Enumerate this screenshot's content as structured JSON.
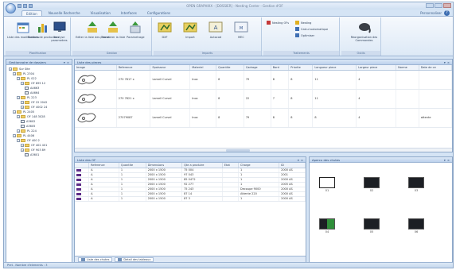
{
  "app": {
    "title": "OPEN GRAPHIXX - [DOSSIER] - Nesting Center - Gestion d'OF",
    "accent": "#3f6fb3"
  },
  "tabs": [
    "Edition",
    "Nouvelle Recherche",
    "Visualisation",
    "Interfaces",
    "Configurations"
  ],
  "active_tab": 0,
  "help": {
    "label": "Personnaliser",
    "icon": "help-icon"
  },
  "ribbon": {
    "groups": [
      {
        "title": "Planification",
        "buttons": [
          "Liste des modifications",
          "Donnes de production",
          "Analyse parametres"
        ]
      },
      {
        "title": "Gestion",
        "buttons": [
          "Editer la liste des pieces",
          "Transferer la liste",
          "Parametrage"
        ]
      },
      {
        "title": "Imports",
        "buttons": [
          "DXF",
          "Import",
          "Autocad",
          "MEC"
        ]
      },
      {
        "title": "Traitements",
        "buttons": [
          "Nesting OFs",
          "Nesting",
          "Calcul automatique",
          "Optimiser"
        ]
      },
      {
        "title": "Outils",
        "buttons": [
          "Reorganisation des Commandes"
        ]
      }
    ]
  },
  "tree_panel": {
    "title": "Gestionnaire de dossiers",
    "nodes": [
      {
        "label": "Sur Site",
        "level": 0,
        "type": "folder"
      },
      {
        "label": "PL 2304",
        "level": 1,
        "type": "folder"
      },
      {
        "label": "PL 022",
        "level": 2,
        "type": "folder"
      },
      {
        "label": "OF 895 12",
        "level": 3,
        "type": "folder"
      },
      {
        "label": "A4663",
        "level": 4,
        "type": "part"
      },
      {
        "label": "A4664",
        "level": 4,
        "type": "part"
      },
      {
        "label": "PL 223",
        "level": 2,
        "type": "folder"
      },
      {
        "label": "OF 22 2042",
        "level": 3,
        "type": "folder"
      },
      {
        "label": "OF 4002 24",
        "level": 3,
        "type": "folder"
      },
      {
        "label": "PL 2405",
        "level": 1,
        "type": "folder"
      },
      {
        "label": "OF 148 3028",
        "level": 2,
        "type": "folder"
      },
      {
        "label": "A3602",
        "level": 3,
        "type": "part"
      },
      {
        "label": "A3605",
        "level": 3,
        "type": "part"
      },
      {
        "label": "PL 224",
        "level": 2,
        "type": "folder"
      },
      {
        "label": "PL 4406",
        "level": 1,
        "type": "folder"
      },
      {
        "label": "OF 400 2",
        "level": 2,
        "type": "folder"
      },
      {
        "label": "OF 402 401",
        "level": 3,
        "type": "folder"
      },
      {
        "label": "OF 903 89",
        "level": 3,
        "type": "folder"
      },
      {
        "label": "A3601",
        "level": 4,
        "type": "part"
      }
    ]
  },
  "parts_panel": {
    "title": "Liste des pieces",
    "columns": [
      "Image",
      "Reference",
      "Epaisseur",
      "Materiel",
      "Quantite",
      "Cadrage",
      "Bord",
      "Priorite",
      "Longueur piece",
      "Largeur piece",
      "Norme",
      "Date de ce"
    ],
    "rows": [
      {
        "ref": "270 7817 x",
        "epaisseur": "Lamell Curvel",
        "materiel": "Inox",
        "quantite": "8",
        "cadrage": "79",
        "bord": "8",
        "priorite": "8",
        "longueur": "11",
        "largeur": "4",
        "norme": "",
        "date": ""
      },
      {
        "ref": "270 7821 x",
        "epaisseur": "Lamell Curvel",
        "materiel": "Inox",
        "quantite": "8",
        "cadrage": "22",
        "bord": "7",
        "priorite": "8",
        "longueur": "11",
        "largeur": "4",
        "norme": "",
        "date": ""
      },
      {
        "ref": "27079087",
        "epaisseur": "Lamell Curvel",
        "materiel": "Inox",
        "quantite": "8",
        "cadrage": "79",
        "bord": "8",
        "priorite": "8",
        "longueur": "8",
        "largeur": "4",
        "norme": "",
        "date": "attente"
      }
    ]
  },
  "of_panel": {
    "title": "Liste des OF",
    "columns": [
      "",
      "Reference",
      "Quantite",
      "Dimensions",
      "Qte a produire",
      "Etat",
      "Charge",
      "ID"
    ],
    "rows": [
      {
        "ref": "A",
        "qte": "1",
        "dim": "2000 x 1500",
        "prod": "75 004",
        "etat": "",
        "charge": "1",
        "id": "2000 AS"
      },
      {
        "ref": "A",
        "qte": "1",
        "dim": "2000 x 1500",
        "prod": "97 043",
        "etat": "",
        "charge": "1",
        "id": "2001"
      },
      {
        "ref": "A",
        "qte": "1",
        "dim": "2000 x 1500",
        "prod": "85 0472",
        "etat": "",
        "charge": "1",
        "id": "2000 AS"
      },
      {
        "ref": "A",
        "qte": "1",
        "dim": "2000 x 1500",
        "prod": "92 277",
        "etat": "",
        "charge": "1",
        "id": "2005 AS"
      },
      {
        "ref": "A",
        "qte": "1",
        "dim": "2000 x 1500",
        "prod": "75 243",
        "etat": "",
        "charge": "Decoupe 9000",
        "id": "2000 AS"
      },
      {
        "ref": "A",
        "qte": "1",
        "dim": "2000 x 1500",
        "prod": "87 14",
        "etat": "",
        "charge": "Attente 220",
        "id": "2000 AS"
      },
      {
        "ref": "A",
        "qte": "1",
        "dim": "2000 x 1500",
        "prod": "87 3",
        "etat": "",
        "charge": "1",
        "id": "2000 AS"
      }
    ],
    "bottom_tabs": [
      "Liste des chutes",
      "Detail des tableaux"
    ]
  },
  "thumb_panel": {
    "title": "Apercu des chutes",
    "items": [
      {
        "caption": "01"
      },
      {
        "caption": "02"
      },
      {
        "caption": "03"
      },
      {
        "caption": "04"
      },
      {
        "caption": "05"
      },
      {
        "caption": "06"
      }
    ]
  },
  "status": {
    "text": "Pret - Nombre d'elements : 3"
  }
}
